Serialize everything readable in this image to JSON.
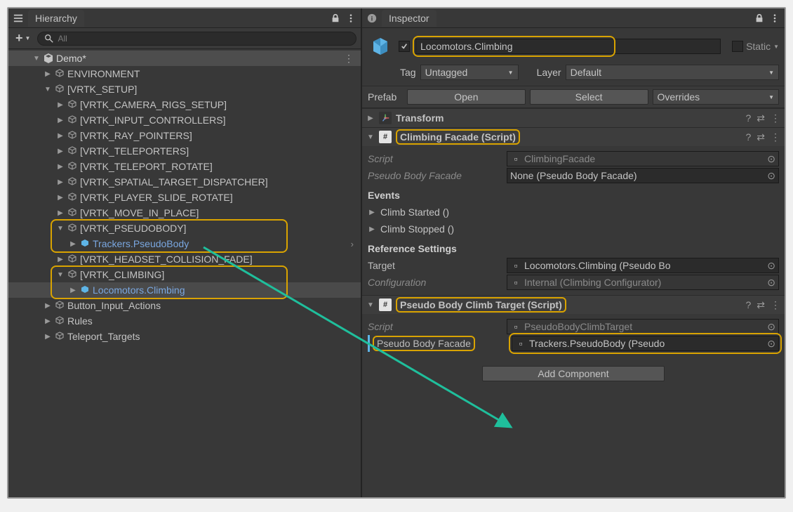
{
  "hierarchy": {
    "title": "Hierarchy",
    "search_placeholder": "All",
    "scene": "Demo*",
    "items": {
      "env": "ENVIRONMENT",
      "vrtk": "[VRTK_SETUP]",
      "camera": "[VRTK_CAMERA_RIGS_SETUP]",
      "input": "[VRTK_INPUT_CONTROLLERS]",
      "ray": "[VRTK_RAY_POINTERS]",
      "tele": "[VRTK_TELEPORTERS]",
      "telerot": "[VRTK_TELEPORT_ROTATE]",
      "spatial": "[VRTK_SPATIAL_TARGET_DISPATCHER]",
      "slide": "[VRTK_PLAYER_SLIDE_ROTATE]",
      "move": "[VRTK_MOVE_IN_PLACE]",
      "pseudo": "[VRTK_PSEUDOBODY]",
      "trackers": "Trackers.PseudoBody",
      "headset": "[VRTK_HEADSET_COLLISION_FADE]",
      "climb": "[VRTK_CLIMBING]",
      "loco": "Locomotors.Climbing",
      "btn": "Button_Input_Actions",
      "rules": "Rules",
      "targets": "Teleport_Targets"
    }
  },
  "inspector": {
    "title": "Inspector",
    "go_name": "Locomotors.Climbing",
    "static": "Static",
    "tag_label": "Tag",
    "tag": "Untagged",
    "layer_label": "Layer",
    "layer": "Default",
    "prefab_label": "Prefab",
    "open": "Open",
    "select": "Select",
    "overrides": "Overrides",
    "transform": "Transform",
    "comp1": {
      "title": "Climbing Facade (Script)",
      "script_label": "Script",
      "script_value": "ClimbingFacade",
      "pbf_label": "Pseudo Body Facade",
      "pbf_value": "None (Pseudo Body Facade)",
      "events": "Events",
      "e1": "Climb Started ()",
      "e2": "Climb Stopped ()",
      "ref": "Reference Settings",
      "target_label": "Target",
      "target_value": "Locomotors.Climbing (Pseudo Bo",
      "config_label": "Configuration",
      "config_value": "Internal (Climbing Configurator)"
    },
    "comp2": {
      "title": "Pseudo Body Climb Target (Script)",
      "script_label": "Script",
      "script_value": "PseudoBodyClimbTarget",
      "pbf_label": "Pseudo Body Facade",
      "pbf_value": "Trackers.PseudoBody (Pseudo"
    },
    "add_component": "Add Component"
  }
}
